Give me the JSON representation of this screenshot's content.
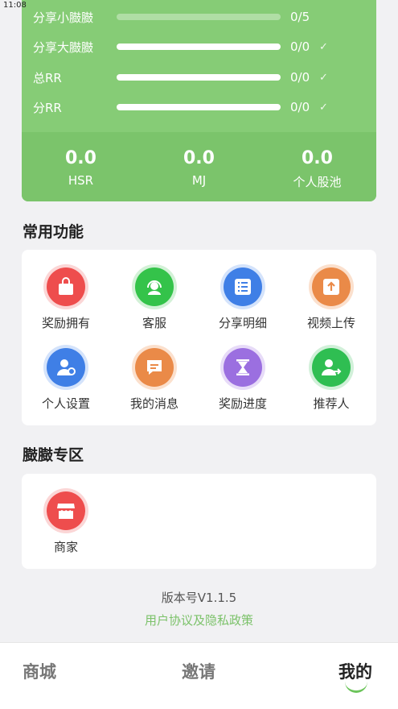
{
  "status_bar": {
    "time": "11:08"
  },
  "progress": [
    {
      "label": "分享小臌臌",
      "value": "0/5",
      "level": 0.0,
      "checked": false
    },
    {
      "label": "分享大臌臌",
      "value": "0/0",
      "level": 1.0,
      "checked": true
    },
    {
      "label": "总RR",
      "value": "0/0",
      "level": 1.0,
      "checked": true
    },
    {
      "label": "分RR",
      "value": "0/0",
      "level": 1.0,
      "checked": true
    }
  ],
  "check_mark": "✓",
  "stats": [
    {
      "value": "0.0",
      "label": "HSR"
    },
    {
      "value": "0.0",
      "label": "MJ"
    },
    {
      "value": "0.0",
      "label": "个人股池"
    }
  ],
  "common": {
    "title": "常用功能",
    "items": [
      {
        "label": "奖励拥有",
        "icon": "bag-icon",
        "color": "#ee4d4d"
      },
      {
        "label": "客服",
        "icon": "headset-icon",
        "color": "#34c34a"
      },
      {
        "label": "分享明细",
        "icon": "list-icon",
        "color": "#3f7fe6"
      },
      {
        "label": "视频上传",
        "icon": "upload-icon",
        "color": "#ea8a48"
      },
      {
        "label": "个人设置",
        "icon": "user-settings-icon",
        "color": "#3f7fe6"
      },
      {
        "label": "我的消息",
        "icon": "message-icon",
        "color": "#ea8a48"
      },
      {
        "label": "奖励进度",
        "icon": "hourglass-icon",
        "color": "#9b6fe0"
      },
      {
        "label": "推荐人",
        "icon": "referrer-icon",
        "color": "#2fbe52"
      }
    ]
  },
  "zone": {
    "title": "臌臌专区",
    "items": [
      {
        "label": "商家",
        "icon": "shop-icon",
        "color": "#ee4d4d"
      }
    ]
  },
  "footer": {
    "version": "版本号V1.1.5",
    "policy": "用户协议及隐私政策"
  },
  "tabs": [
    {
      "label": "商城",
      "active": false
    },
    {
      "label": "邀请",
      "active": false
    },
    {
      "label": "我的",
      "active": true
    }
  ]
}
